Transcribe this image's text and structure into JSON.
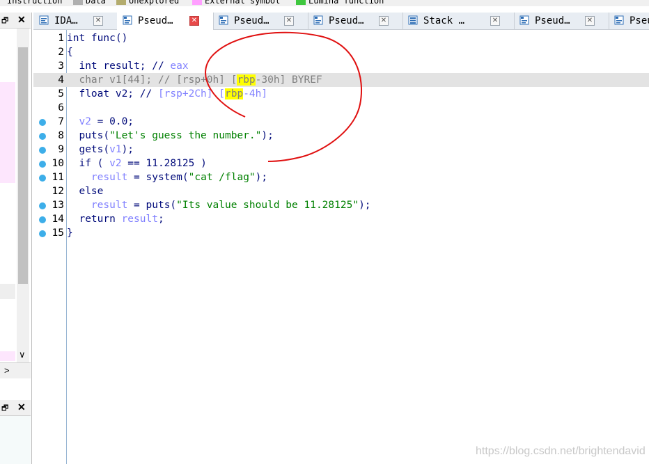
{
  "legend": [
    {
      "label": "Instruction",
      "color": "#b0b0ff"
    },
    {
      "label": "Data",
      "color": "#b0b0b0"
    },
    {
      "label": "Unexplored",
      "color": "#b4ac6e"
    },
    {
      "label": "External symbol",
      "color": "#ffa0ff"
    },
    {
      "label": "Lumina function",
      "color": "#3fc73f"
    }
  ],
  "tabs": [
    {
      "label": "IDA…",
      "icon": "ida-view-icon",
      "active": false
    },
    {
      "label": "Pseud…",
      "icon": "pseudocode-icon",
      "active": true
    },
    {
      "label": "Pseud…",
      "icon": "pseudocode-icon",
      "active": false
    },
    {
      "label": "Pseud…",
      "icon": "pseudocode-icon",
      "active": false
    },
    {
      "label": "Stack …",
      "icon": "stack-icon",
      "active": false
    },
    {
      "label": "Pseud…",
      "icon": "pseudocode-icon",
      "active": false
    },
    {
      "label": "Pseu",
      "icon": "pseudocode-icon",
      "active": false
    }
  ],
  "close_glyph": "✕",
  "left_pane": {
    "close_glyph": "✕",
    "pin_glyph": "🗗",
    "scroll_down": "∨",
    "scroll_right": ">"
  },
  "code": {
    "current_line": 4,
    "lines": [
      {
        "n": "1",
        "bp": false,
        "segs": [
          [
            "kw",
            "int func()"
          ]
        ]
      },
      {
        "n": "2",
        "bp": false,
        "segs": [
          [
            "kw",
            "{"
          ]
        ]
      },
      {
        "n": "3",
        "bp": false,
        "segs": [
          [
            "kw",
            "  int result; // "
          ],
          [
            "var",
            "eax"
          ]
        ]
      },
      {
        "n": "4",
        "bp": false,
        "segs": [
          [
            "gray",
            "  char v1["
          ],
          [
            "gray",
            "44"
          ],
          [
            "gray",
            "]; // [rsp+0h] ["
          ],
          [
            "hl",
            "rbp"
          ],
          [
            "gray",
            "-30h] BYREF"
          ]
        ]
      },
      {
        "n": "5",
        "bp": false,
        "segs": [
          [
            "kw",
            "  float v2; // "
          ],
          [
            "cmt",
            "[rsp+2Ch] ["
          ],
          [
            "hl",
            "rbp"
          ],
          [
            "cmt",
            "-4h]"
          ]
        ]
      },
      {
        "n": "6",
        "bp": false,
        "segs": []
      },
      {
        "n": "7",
        "bp": true,
        "segs": [
          [
            "var",
            "  v2"
          ],
          [
            "kw",
            " = 0.0;"
          ]
        ]
      },
      {
        "n": "8",
        "bp": true,
        "segs": [
          [
            "kw",
            "  puts("
          ],
          [
            "str",
            "\"Let's guess the number.\""
          ],
          [
            "kw",
            ");"
          ]
        ]
      },
      {
        "n": "9",
        "bp": true,
        "segs": [
          [
            "kw",
            "  gets("
          ],
          [
            "var",
            "v1"
          ],
          [
            "kw",
            ");"
          ]
        ]
      },
      {
        "n": "10",
        "bp": true,
        "segs": [
          [
            "kw",
            "  if ( "
          ],
          [
            "var",
            "v2"
          ],
          [
            "kw",
            " == 11.28125 )"
          ]
        ]
      },
      {
        "n": "11",
        "bp": true,
        "segs": [
          [
            "var",
            "    result"
          ],
          [
            "kw",
            " = system("
          ],
          [
            "str",
            "\"cat /flag\""
          ],
          [
            "kw",
            ");"
          ]
        ]
      },
      {
        "n": "12",
        "bp": false,
        "segs": [
          [
            "kw",
            "  else"
          ]
        ]
      },
      {
        "n": "13",
        "bp": true,
        "segs": [
          [
            "var",
            "    result"
          ],
          [
            "kw",
            " = puts("
          ],
          [
            "str",
            "\"Its value should be 11.28125\""
          ],
          [
            "kw",
            ");"
          ]
        ]
      },
      {
        "n": "14",
        "bp": true,
        "segs": [
          [
            "kw",
            "  return "
          ],
          [
            "var",
            "result"
          ],
          [
            "kw",
            ";"
          ]
        ]
      },
      {
        "n": "15",
        "bp": true,
        "segs": [
          [
            "kw",
            "}"
          ]
        ]
      }
    ]
  },
  "watermark": "https://blog.csdn.net/brightendavid",
  "colors": {
    "breakpoint": "#3daee9",
    "highlight": "#ffff00",
    "annotation": "#e01010"
  }
}
